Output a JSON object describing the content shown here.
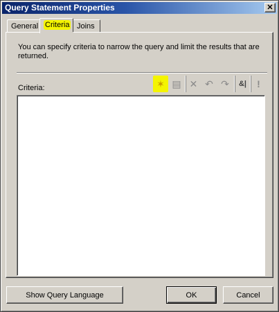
{
  "window": {
    "title": "Query Statement Properties"
  },
  "tabs": [
    {
      "label": "General"
    },
    {
      "label": "Criteria"
    },
    {
      "label": "Joins"
    }
  ],
  "description": "You can specify criteria to narrow the query and limit the results that are returned.",
  "criteria": {
    "label": "Criteria:",
    "value": ""
  },
  "toolbar": {
    "highlight_color": "#f4f400",
    "icons": [
      {
        "name": "new-criterion-icon",
        "glyph": "✶"
      },
      {
        "name": "properties-icon",
        "glyph": "▤"
      },
      {
        "name": "delete-icon",
        "glyph": "✕"
      },
      {
        "name": "undo-icon",
        "glyph": "↶"
      },
      {
        "name": "redo-icon",
        "glyph": "↷"
      },
      {
        "name": "and-or-icon",
        "glyph": "&|"
      },
      {
        "name": "not-icon",
        "glyph": "!"
      }
    ]
  },
  "buttons": {
    "show_query_language": "Show Query Language",
    "ok": "OK",
    "cancel": "Cancel"
  },
  "colors": {
    "title_bar": "#0a246a",
    "dialog_bg": "#d4d0c8",
    "tab_highlight": "#f4f400"
  }
}
